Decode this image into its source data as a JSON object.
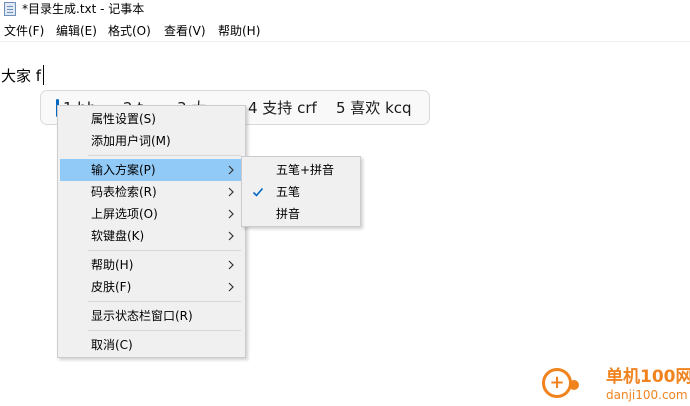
{
  "window": {
    "title": "*目录生成.txt - 记事本"
  },
  "menubar": {
    "items": [
      {
        "label": "文件(F)"
      },
      {
        "label": "编辑(E)"
      },
      {
        "label": "格式(O)"
      },
      {
        "label": "查看(V)"
      },
      {
        "label": "帮助(H)"
      }
    ]
  },
  "editor": {
    "typed_text": "大家 f"
  },
  "ime": {
    "candidates": [
      {
        "label": "1 bh"
      },
      {
        "label": "2 t"
      },
      {
        "label": "3 大"
      },
      {
        "label": "4 支持 crf"
      },
      {
        "label": "5 喜欢 kcq"
      }
    ]
  },
  "context_menu": {
    "items": [
      {
        "label": "属性设置(S)"
      },
      {
        "label": "添加用户词(M)"
      },
      {
        "label": "输入方案(P)",
        "submenu": true,
        "highlighted": true
      },
      {
        "label": "码表检索(R)",
        "submenu": true
      },
      {
        "label": "上屏选项(O)",
        "submenu": true
      },
      {
        "label": "软键盘(K)",
        "submenu": true
      },
      {
        "label": "帮助(H)",
        "submenu": true
      },
      {
        "label": "皮肤(F)",
        "submenu": true
      },
      {
        "label": "显示状态栏窗口(R)"
      },
      {
        "label": "取消(C)"
      }
    ]
  },
  "submenu": {
    "items": [
      {
        "label": "五笔+拼音",
        "checked": false
      },
      {
        "label": "五笔",
        "checked": true
      },
      {
        "label": "拼音",
        "checked": false
      }
    ]
  },
  "watermark": {
    "name": "单机100网",
    "url": "danji100.com"
  },
  "colors": {
    "highlight": "#91c9f7",
    "accent": "#0067c0",
    "watermark": "#f0831e"
  }
}
